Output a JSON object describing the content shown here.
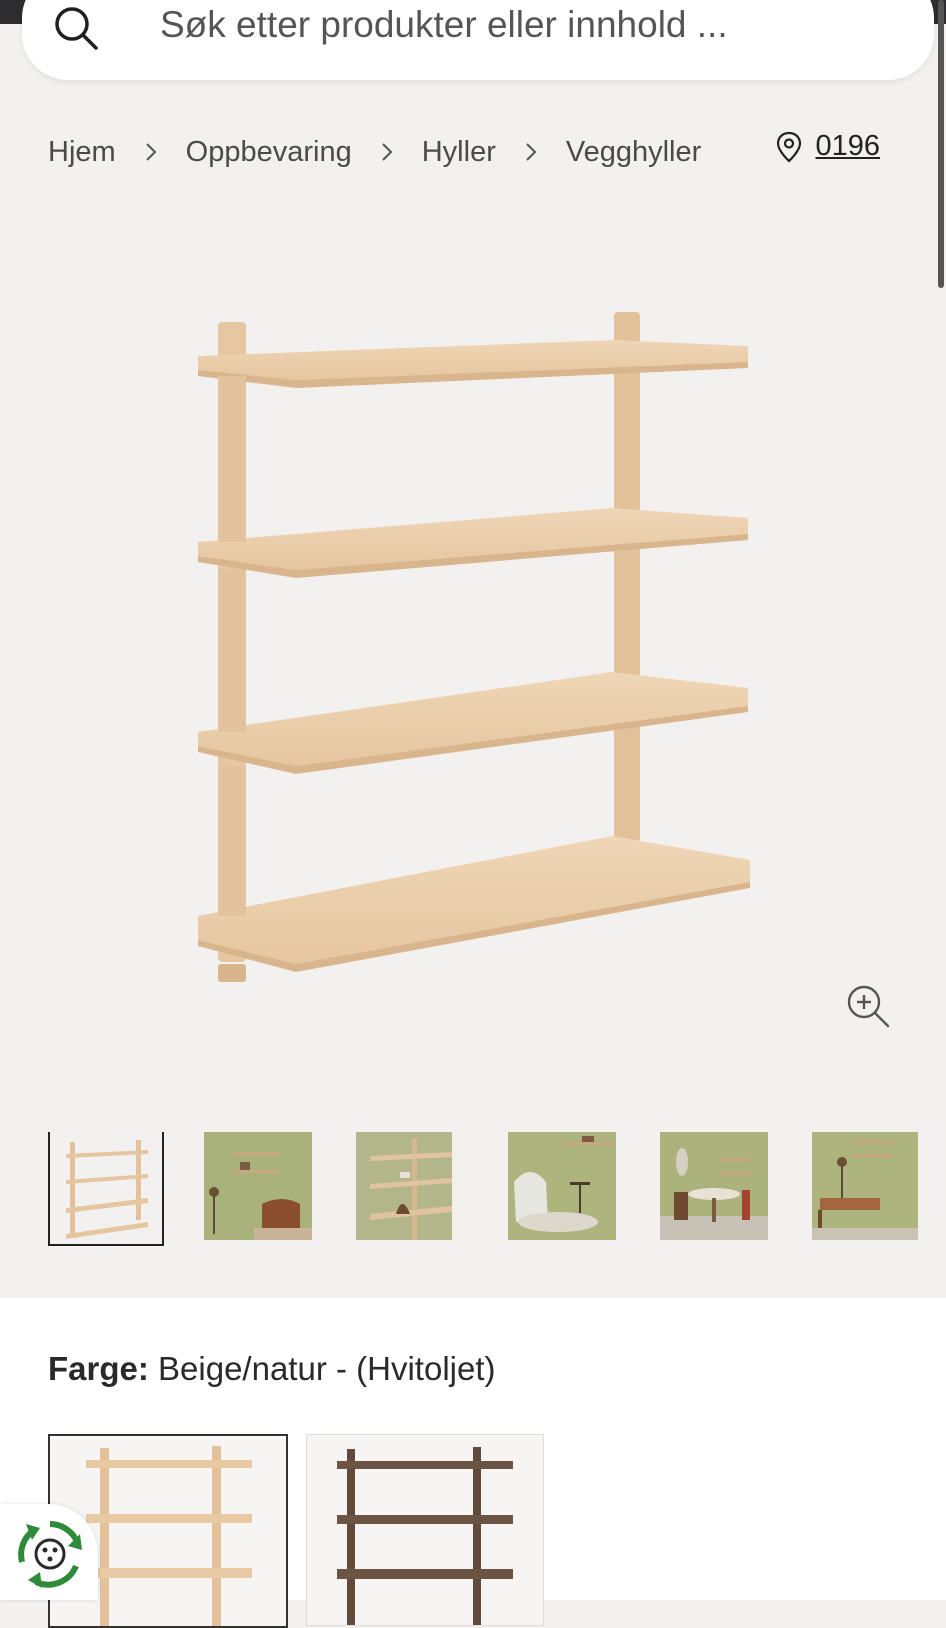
{
  "search": {
    "placeholder": "Søk etter produkter eller innhold ..."
  },
  "breadcrumb": [
    {
      "label": "Hjem"
    },
    {
      "label": "Oppbevaring"
    },
    {
      "label": "Hyller"
    },
    {
      "label": "Vegghyller"
    }
  ],
  "postal_code": "0196",
  "product": {
    "color_label": "Farge:",
    "color_value": " Beige/natur - (Hvitoljet)"
  },
  "icons": [
    "search-icon",
    "chevron-right-icon",
    "location-pin-icon",
    "zoom-in-icon",
    "recycle-icon"
  ],
  "colors": {
    "background": "#f3f1ef",
    "wood_light": "#e8c9a4",
    "wood_dark": "#6b5443",
    "thumb_green": "#a9b27a"
  }
}
